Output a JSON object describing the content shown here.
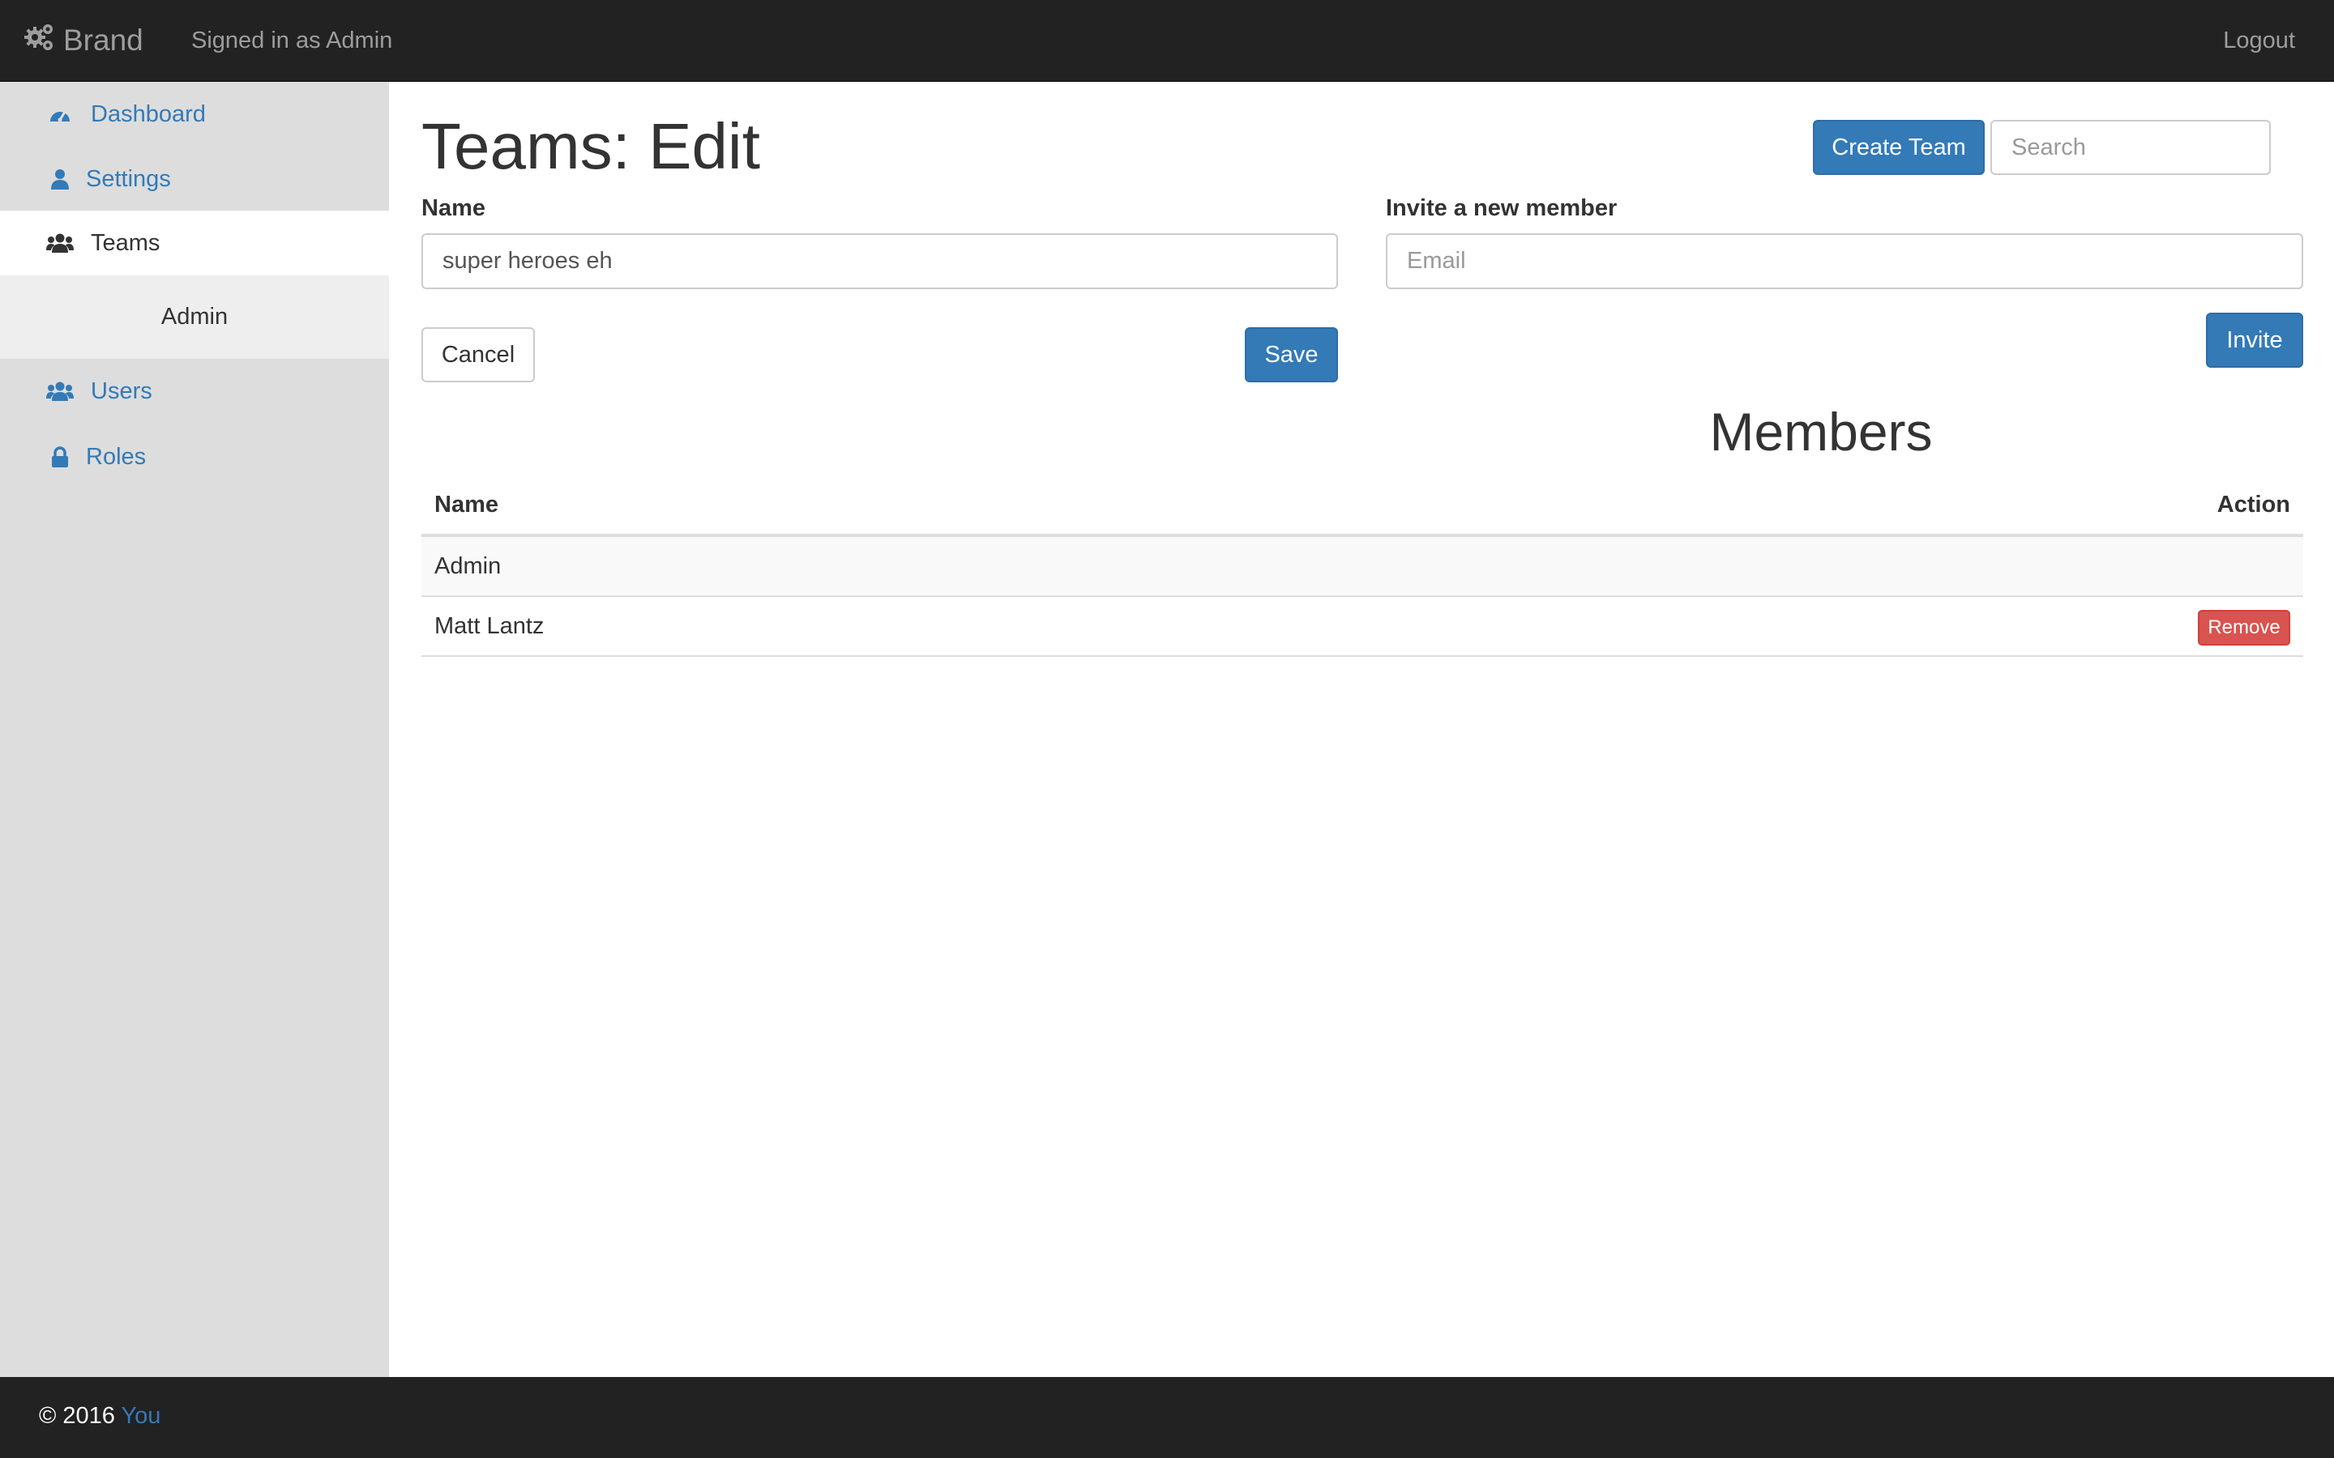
{
  "navbar": {
    "brand": "Brand",
    "brand_icon": "cogs-icon",
    "signed_in": "Signed in as Admin",
    "logout": "Logout"
  },
  "sidebar": {
    "items": [
      {
        "label": "Dashboard",
        "icon": "dashboard-icon"
      },
      {
        "label": "Settings",
        "icon": "user-icon"
      },
      {
        "label": "Teams",
        "icon": "users-icon",
        "active": true
      },
      {
        "label": "Admin",
        "sub": true
      },
      {
        "label": "Users",
        "icon": "users-icon"
      },
      {
        "label": "Roles",
        "icon": "lock-icon"
      }
    ]
  },
  "main": {
    "title": "Teams: Edit",
    "create_team": "Create Team",
    "search_placeholder": "Search",
    "form": {
      "name_label": "Name",
      "name_value": "super heroes eh",
      "cancel": "Cancel",
      "save": "Save",
      "invite_label": "Invite a new member",
      "email_placeholder": "Email",
      "invite": "Invite"
    },
    "members": {
      "title": "Members",
      "columns": [
        "Name",
        "Action"
      ],
      "rows": [
        {
          "name": "Admin",
          "action": ""
        },
        {
          "name": "Matt Lantz",
          "action": "Remove"
        }
      ]
    }
  },
  "footer": {
    "copyright": "© 2016",
    "link": "You"
  },
  "colors": {
    "primary": "#337ab7",
    "danger": "#d9534f",
    "navbar": "#222222",
    "sidebar": "#dddddd"
  }
}
